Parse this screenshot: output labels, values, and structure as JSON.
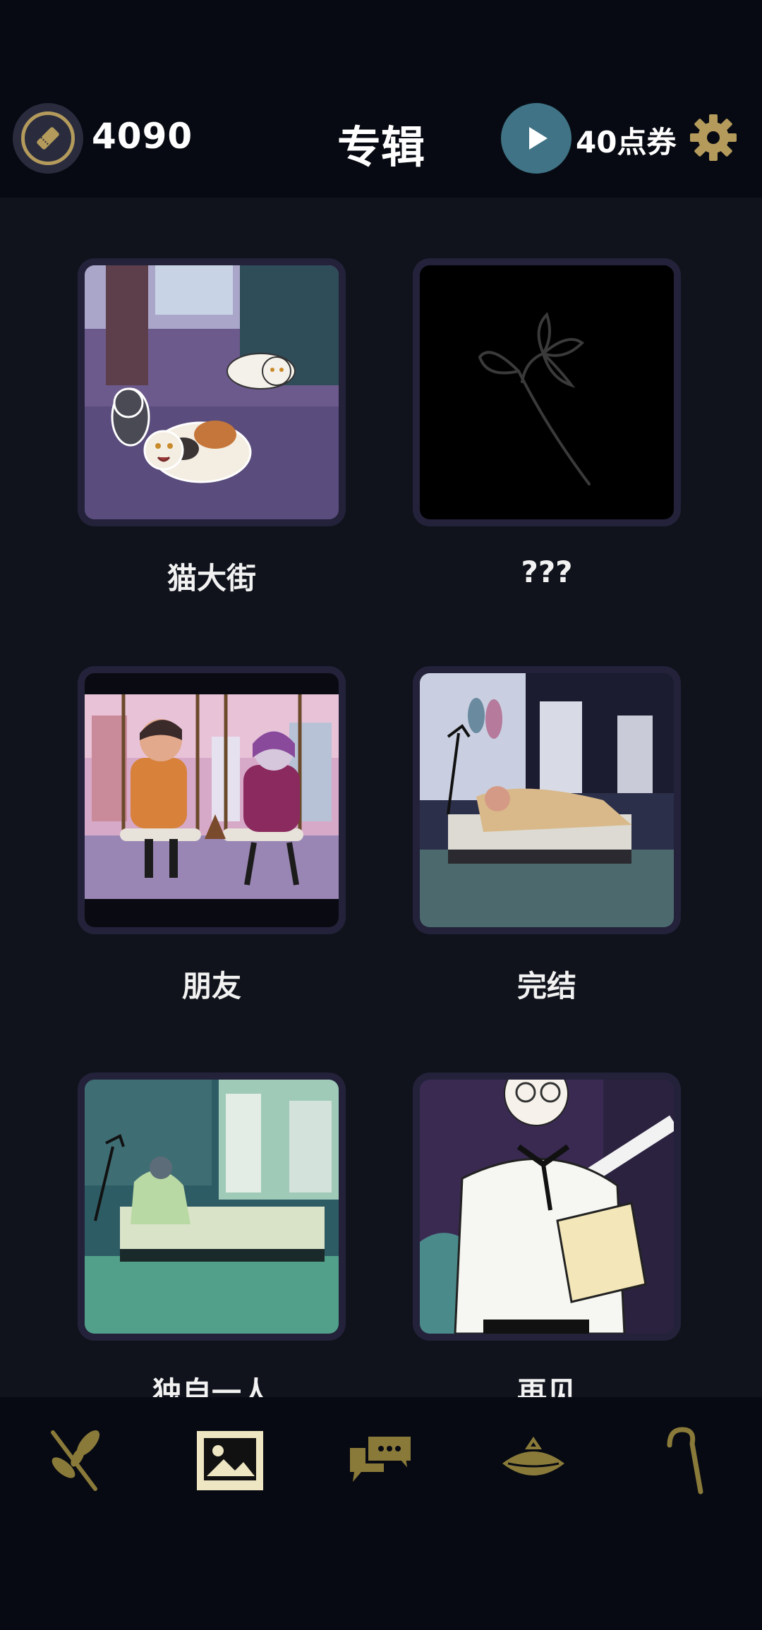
{
  "header": {
    "ticket_count": "4090",
    "title": "专辑",
    "coupon_label": "40点券"
  },
  "albums": [
    {
      "label": "猫大街",
      "icon": "cats-street-illustration"
    },
    {
      "label": "???",
      "icon": "locked-flower-silhouette"
    },
    {
      "label": "朋友",
      "icon": "friends-on-swing-illustration"
    },
    {
      "label": "完结",
      "icon": "sleeping-in-bed-illustration"
    },
    {
      "label": "独自一人",
      "icon": "alone-in-room-illustration"
    },
    {
      "label": "再见",
      "icon": "boy-with-book-illustration"
    }
  ],
  "nav": [
    {
      "icon": "branch-icon"
    },
    {
      "icon": "album-image-icon",
      "active": true
    },
    {
      "icon": "chat-bubbles-icon"
    },
    {
      "icon": "hat-icon"
    },
    {
      "icon": "cane-icon"
    }
  ],
  "colors": {
    "accent": "#b49b5c",
    "play_button": "#3f7385",
    "background": "#10131c",
    "bar": "#070a12"
  }
}
